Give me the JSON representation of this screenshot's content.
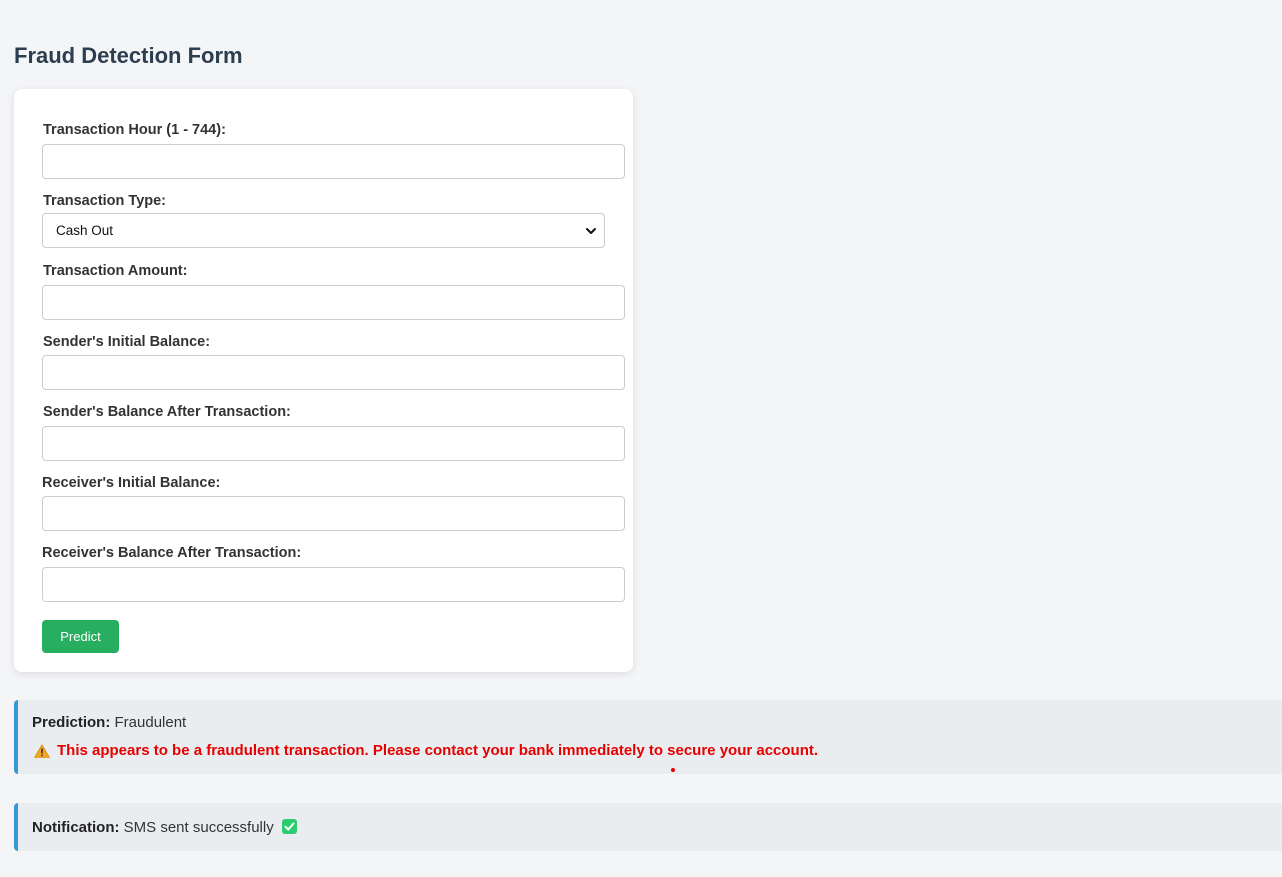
{
  "page": {
    "title": "Fraud Detection Form"
  },
  "form": {
    "fields": [
      {
        "label": "Transaction Hour (1 - 744):",
        "value": "",
        "placeholder": ""
      },
      {
        "label": "Transaction Type:",
        "selected": "Cash Out"
      },
      {
        "label": "Transaction Amount:",
        "value": "",
        "placeholder": ""
      },
      {
        "label": "Sender's Initial Balance:",
        "value": "",
        "placeholder": ""
      },
      {
        "label": "Sender's Balance After Transaction:",
        "value": "",
        "placeholder": ""
      },
      {
        "label": "Receiver's Initial Balance:",
        "value": "",
        "placeholder": ""
      },
      {
        "label": "Receiver's Balance After Transaction:",
        "value": "",
        "placeholder": ""
      }
    ],
    "submit_label": "Predict"
  },
  "prediction": {
    "label": "Prediction:",
    "value": "Fraudulent",
    "warning_icon": "warning-icon",
    "warning_text": "This appears to be a fraudulent transaction. Please contact your bank immediately to secure your account."
  },
  "notification": {
    "label": "Notification:",
    "value": "SMS sent successfully",
    "status_icon": "check-icon"
  },
  "colors": {
    "accent_border": "#3498db",
    "button": "#27ae60",
    "warning_text": "#e60000",
    "check": "#2ecc71"
  }
}
